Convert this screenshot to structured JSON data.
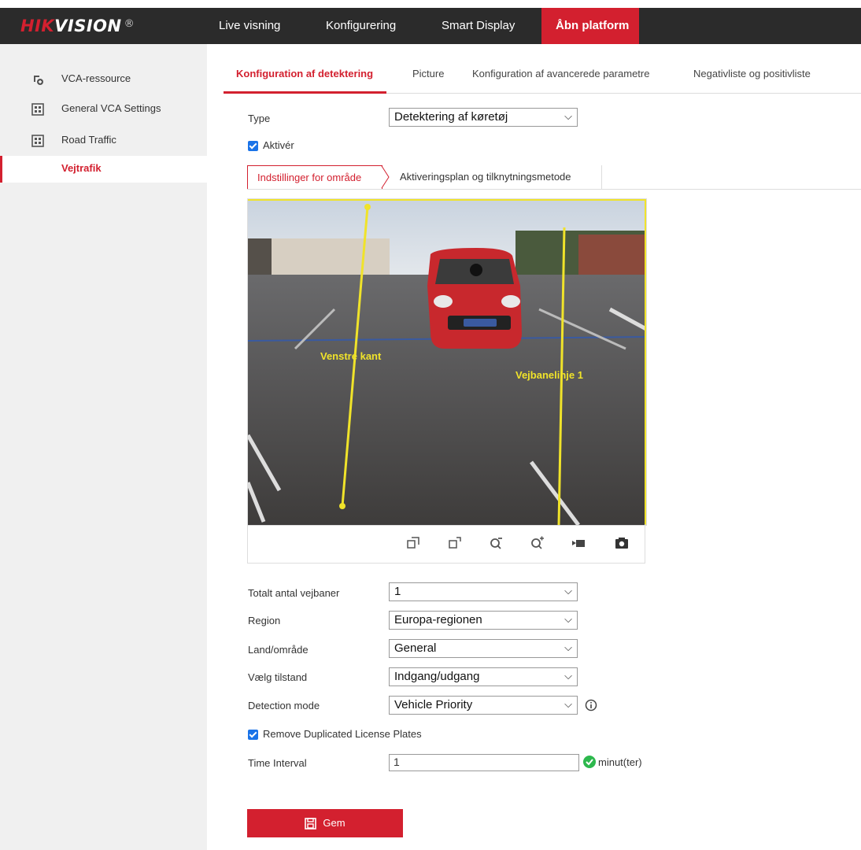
{
  "brand": {
    "hik": "HIK",
    "vision": "VISION",
    "reg": "®"
  },
  "nav": [
    "Live visning",
    "Konfigurering",
    "Smart Display",
    "Åbn platform"
  ],
  "sidebar": {
    "items": [
      "VCA-ressource",
      "General VCA Settings",
      "Road Traffic",
      "Vejtrafik"
    ]
  },
  "tabs": [
    "Konfiguration af detektering",
    "Picture",
    "Konfiguration af avancerede parametre",
    "Negativliste og positivliste"
  ],
  "type": {
    "label": "Type",
    "value": "Detektering af køretøj"
  },
  "enable": {
    "label": "Aktivér",
    "checked": true
  },
  "subtabs": [
    "Indstillinger for område",
    "Aktiveringsplan og tilknytningsmetode"
  ],
  "video": {
    "left_edge_label": "Venstre kant",
    "lane_line_label": "Vejbanelinje 1"
  },
  "form": {
    "total_lanes": {
      "label": "Totalt antal vejbaner",
      "value": "1"
    },
    "region": {
      "label": "Region",
      "value": "Europa-regionen"
    },
    "country": {
      "label": "Land/område",
      "value": "General"
    },
    "mode": {
      "label": "Vælg tilstand",
      "value": "Indgang/udgang"
    },
    "detection_mode": {
      "label": "Detection mode",
      "value": "Vehicle Priority"
    },
    "remove_dup": {
      "label": "Remove Duplicated License Plates",
      "checked": true
    },
    "time_interval": {
      "label": "Time Interval",
      "value": "1",
      "unit": "minut(ter)"
    }
  },
  "save": {
    "label": "Gem"
  },
  "colors": {
    "accent": "#d3202f",
    "topbar": "#2b2b2b",
    "check": "#1a73e8",
    "ok": "#2db84d"
  }
}
